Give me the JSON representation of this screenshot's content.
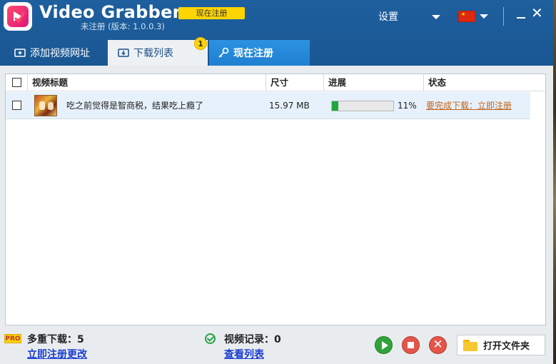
{
  "app": {
    "title": "Video Grabber",
    "register_badge": "现在注册",
    "version": "未注册 (版本: 1.0.0.3)",
    "settings_label": "设置",
    "language_flag": "china-flag-icon"
  },
  "tabs": [
    {
      "label": "添加视频网址",
      "icon": "add-video-icon"
    },
    {
      "label": "下载列表",
      "icon": "download-list-icon",
      "badge": "1"
    },
    {
      "label": "现在注册",
      "icon": "key-icon"
    }
  ],
  "table": {
    "headers": [
      "视频标题",
      "尺寸",
      "进展",
      "状态"
    ],
    "rows": [
      {
        "title": "吃之前觉得是智商税，结果吃上瘾了",
        "size": "15.97 MB",
        "progress": 0.11,
        "progress_label": "11%",
        "status": "要完成下载：立即注册"
      }
    ]
  },
  "footer": {
    "pro_badge": "PRO",
    "multi_download_label": "多重下载：5",
    "register_link": "立即注册更改",
    "history_label": "视频记录：0",
    "view_list_link": "查看列表",
    "open_folder_label": "打开文件夹"
  },
  "colors": {
    "titlebar": "#1a5793",
    "accent_tab": "#1f7fd0",
    "progress": "#1fa83d",
    "status_link": "#c0651d"
  }
}
